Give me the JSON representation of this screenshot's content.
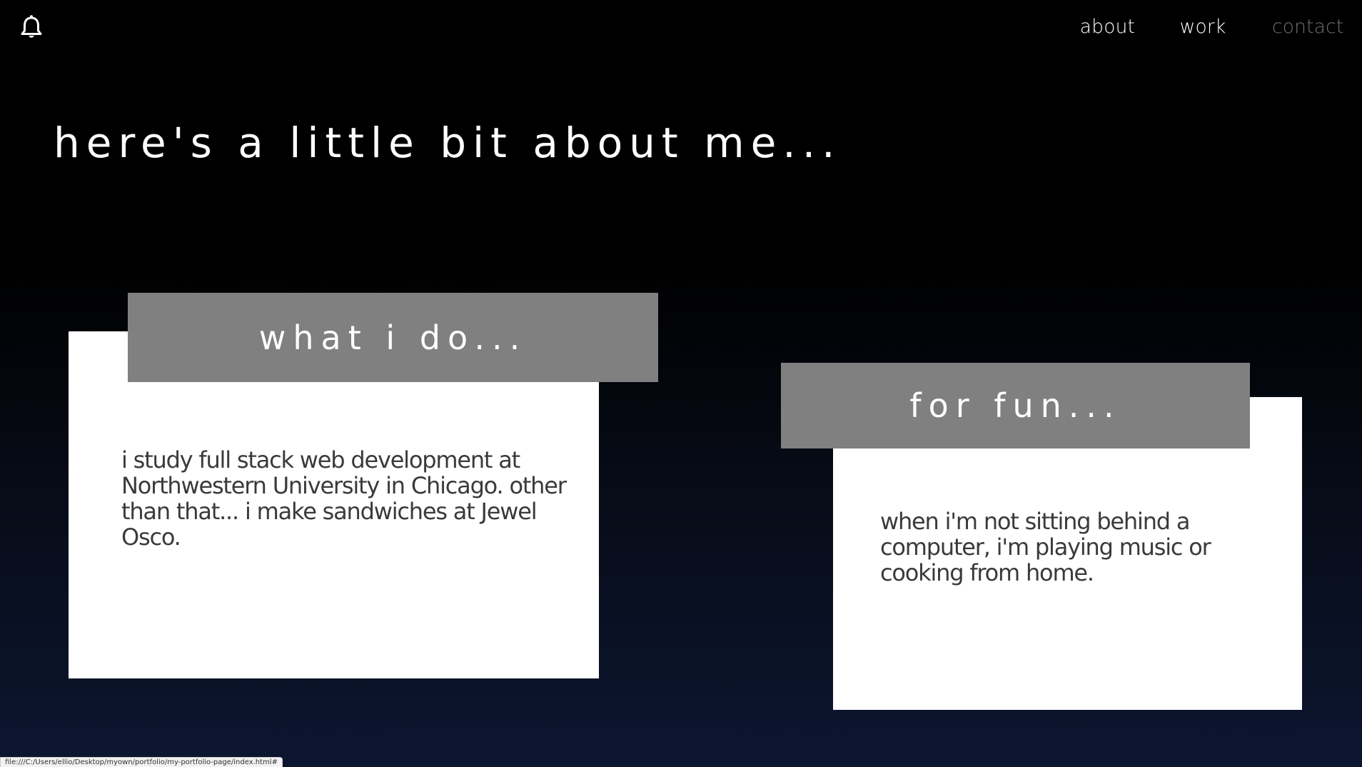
{
  "header": {
    "logo_icon": "bell-icon",
    "nav": [
      {
        "label": "about",
        "color": "#ffffff"
      },
      {
        "label": "work",
        "color": "#ffffff"
      },
      {
        "label": "contact",
        "color": "#6f6f6f"
      }
    ]
  },
  "main": {
    "heading": "here's a little bit about me...",
    "cards": [
      {
        "title": "what i do...",
        "body": "i study full stack web development at Northwestern University in Chicago. other than that... i make sandwiches at Jewel Osco."
      },
      {
        "title": "for fun...",
        "body": "when i'm not sitting behind a computer, i'm playing music or cooking from home."
      }
    ]
  },
  "status_bar": {
    "url": "file:///C:/Users/ellio/Desktop/myown/portfolio/my-portfolio-page/index.html#"
  },
  "colors": {
    "background_top": "#000000",
    "background_bottom": "#0c1630",
    "card_tab": "#808080",
    "card_body": "#ffffff",
    "body_text": "#3a3a3a"
  }
}
